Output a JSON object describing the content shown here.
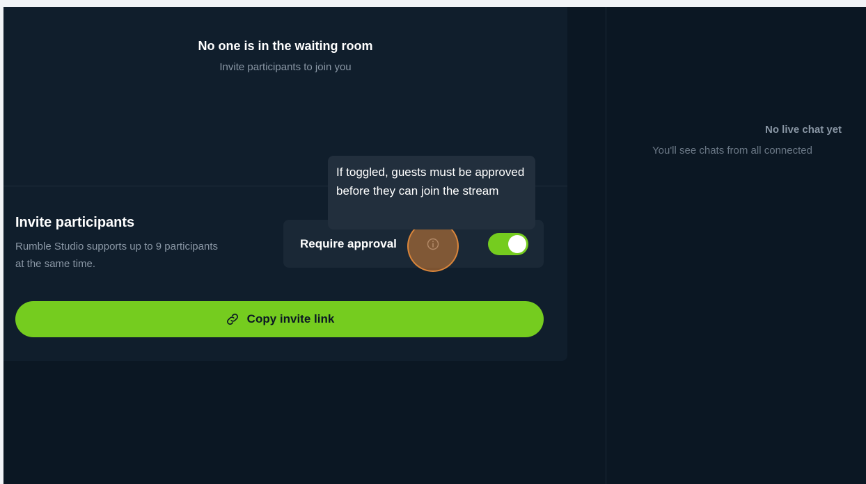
{
  "waiting_room": {
    "title": "No one is in the waiting room",
    "subtitle": "Invite participants to join you"
  },
  "invite": {
    "title": "Invite participants",
    "description": "Rumble Studio supports up to 9 participants at the same time.",
    "copy_button_label": "Copy invite link"
  },
  "approval": {
    "label": "Require approval",
    "toggle_on": true,
    "tooltip": "If toggled, guests must be approved before they can join the stream"
  },
  "chat": {
    "title": "No live chat yet",
    "subtitle": "You'll see chats from all connected"
  },
  "colors": {
    "accent": "#75cc1f",
    "background": "#0b1723",
    "panel": "#101e2c"
  },
  "icons": [
    "info-icon",
    "link-icon"
  ]
}
